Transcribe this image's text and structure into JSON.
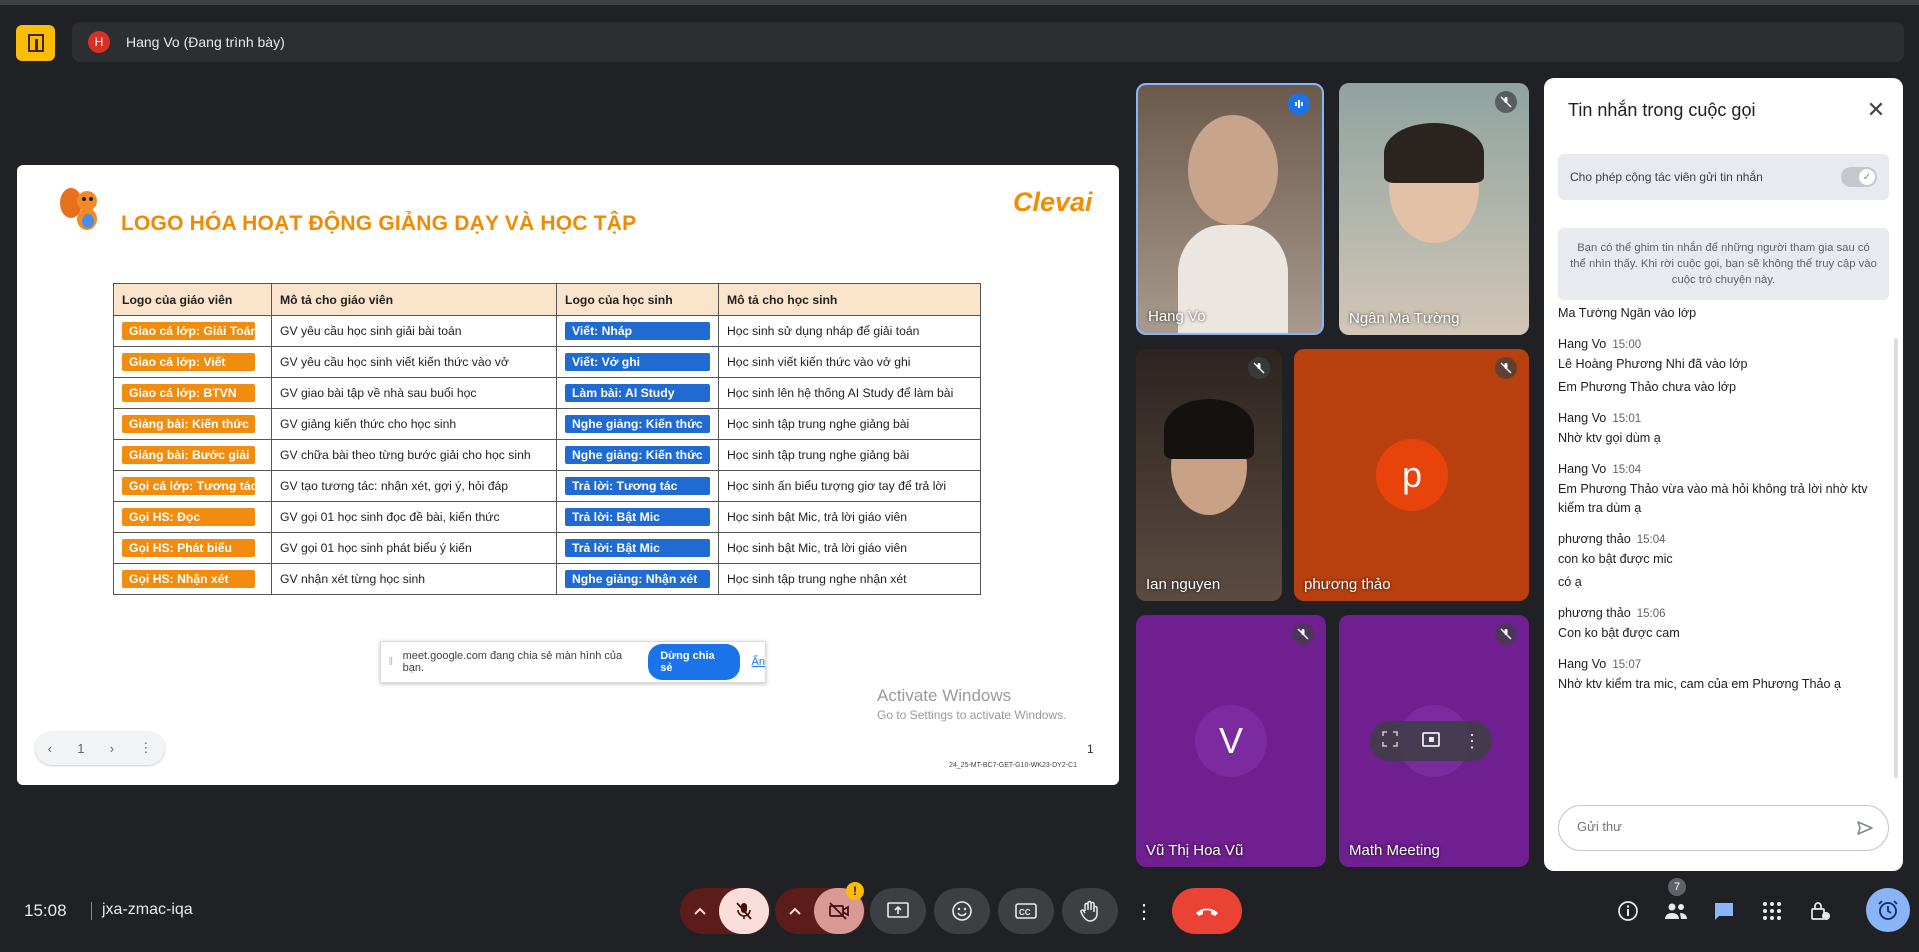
{
  "presenter": {
    "initial": "H",
    "label": "Hang Vo (Đang trình bày)"
  },
  "slide": {
    "title": "LOGO HÓA HOẠT ĐỘNG GIẢNG DẠY VÀ HỌC TẬP",
    "brand": "Clevai",
    "headers": [
      "Logo của giáo viên",
      "Mô tả cho giáo viên",
      "Logo của học sinh",
      "Mô tả cho học sinh"
    ],
    "rows": [
      [
        "Giao cá lớp: Giải Toán",
        "GV yêu cầu học sinh giải bài toán",
        "Viết: Nháp",
        "Học sinh sử dụng nháp để giải toán"
      ],
      [
        "Giao cá lớp: Viết",
        "GV yêu cầu học sinh viết kiến thức vào vở",
        "Viết: Vở ghi",
        "Học sinh viết kiến thức vào vở ghi"
      ],
      [
        "Giao cá lớp: BTVN",
        "GV giao bài tập về nhà sau buổi học",
        "Làm bài: AI Study",
        "Học sinh lên hệ thống AI Study để làm bài"
      ],
      [
        "Giảng bài: Kiến thức",
        "GV giảng kiến thức cho học sinh",
        "Nghe giảng: Kiến thức",
        "Học sinh tập trung nghe giảng bài"
      ],
      [
        "Giảng bài: Bước giải",
        "GV chữa bài theo từng bước giải cho học sinh",
        "Nghe giảng: Kiến thức",
        "Học sinh tập trung nghe giảng bài"
      ],
      [
        "Gọi cá lớp: Tương tác",
        "GV tạo tương tác: nhận xét, gợi ý, hỏi đáp",
        "Trả lời: Tương tác",
        "Học sinh ấn biểu tượng giơ tay để trả lời"
      ],
      [
        "Gọi HS: Đọc",
        "GV gọi 01 học sinh đọc đề bài, kiến thức",
        "Trả lời: Bật Mic",
        "Học sinh bật Mic, trả lời giáo viên"
      ],
      [
        "Gọi HS: Phát biểu",
        "GV gọi 01 học sinh phát biểu ý kiến",
        "Trả lời: Bật Mic",
        "Học sinh bật Mic, trả lời giáo viên"
      ],
      [
        "Gọi HS: Nhận xét",
        "GV nhận xét từng học sinh",
        "Nghe giảng: Nhận xét",
        "Học sinh tập trung nghe nhận xét"
      ]
    ],
    "share_bar": {
      "text": "meet.google.com đang chia sẻ màn hình của bạn.",
      "stop": "Dừng chia sẻ",
      "hide": "Ẩn"
    },
    "activate": {
      "line1": "Activate Windows",
      "line2": "Go to Settings to activate Windows."
    },
    "nav": {
      "page": "1"
    },
    "page_number": "1",
    "code": "24_25-MT-BC7-GET-G10-WK23-DY2-C1"
  },
  "tiles": {
    "hang": {
      "name": "Hang Vo"
    },
    "ngan": {
      "name": "Ngân Ma Tường"
    },
    "ian": {
      "name": "Ian nguyen"
    },
    "phuong": {
      "name": "phương thảo",
      "initial": "p"
    },
    "vu": {
      "name": "Vũ Thị Hoa Vũ",
      "initial": "V"
    },
    "math": {
      "name": "Math Meeting"
    }
  },
  "chat": {
    "title": "Tin nhắn trong cuộc gọi",
    "allow_label": "Cho phép cộng tác viên gửi tin nhắn",
    "pin_note": "Bạn có thể ghim tin nhắn để những người tham gia sau có thể nhìn thấy. Khi rời cuộc gọi, bạn sẽ không thể truy cập vào cuộc trò chuyện này.",
    "partial_line": "Ma Tường Ngân vào lớp",
    "messages": [
      {
        "sender": "Hang Vo",
        "time": "15:00",
        "lines": [
          "Lê Hoàng Phương Nhi đã vào lớp",
          "Em Phương Thảo chưa vào lớp"
        ]
      },
      {
        "sender": "Hang Vo",
        "time": "15:01",
        "lines": [
          "Nhờ ktv gọi dùm ạ"
        ]
      },
      {
        "sender": "Hang Vo",
        "time": "15:04",
        "lines": [
          "Em Phương Thảo vừa vào mà hỏi không trả lời nhờ ktv kiểm tra dùm ạ"
        ]
      },
      {
        "sender": "phương thảo",
        "time": "15:04",
        "lines": [
          "con ko bật được mic",
          "có ạ"
        ]
      },
      {
        "sender": "phương thảo",
        "time": "15:06",
        "lines": [
          "Con ko bật được cam"
        ]
      },
      {
        "sender": "Hang Vo",
        "time": "15:07",
        "lines": [
          "Nhờ ktv kiểm tra mic, cam của em Phương Thảo ạ"
        ]
      }
    ],
    "input_placeholder": "Gửi thư"
  },
  "bottom": {
    "clock": "15:08",
    "meeting_code": "jxa-zmac-iqa",
    "people_count": "7",
    "warn": "!"
  },
  "colors": {
    "accent_orange": "#f28c0f",
    "accent_blue": "#1f6bd1",
    "end_call": "#ea4335"
  }
}
